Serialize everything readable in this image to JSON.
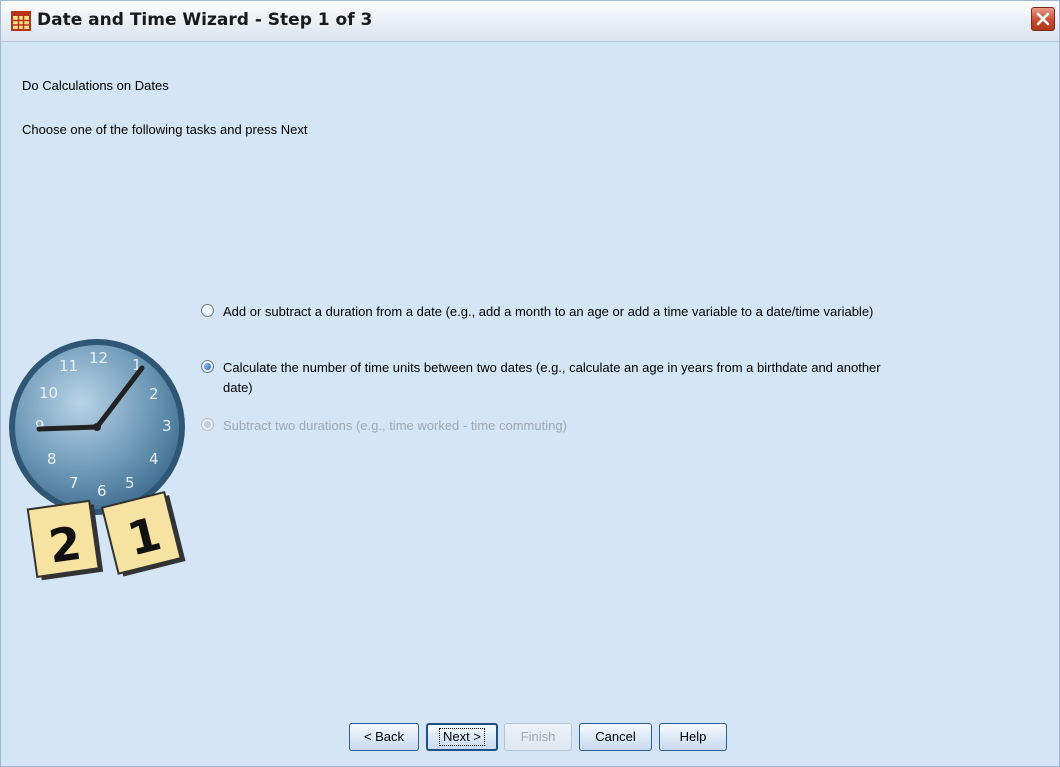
{
  "window": {
    "title": "Date and Time Wizard - Step 1 of 3",
    "app_icon": "spreadsheet-icon",
    "close_icon": "close-icon"
  },
  "content": {
    "heading": "Do Calculations on Dates",
    "instruction": "Choose one of the following tasks and press Next",
    "illustration": "clock-calendar-icon",
    "options": [
      {
        "label": "Add or subtract a duration from a date (e.g., add a month to an age or add a time variable to a date/time variable)",
        "checked": false,
        "enabled": true
      },
      {
        "label": "Calculate the number of time units between two dates (e.g., calculate an age in years from a birthdate and another date)",
        "checked": true,
        "enabled": true
      },
      {
        "label": "Subtract two durations (e.g., time worked - time commuting)",
        "checked": false,
        "enabled": false
      }
    ]
  },
  "buttons": {
    "back": "< Back",
    "next": "Next >",
    "finish": "Finish",
    "cancel": "Cancel",
    "help": "Help"
  },
  "colors": {
    "background": "#d4e5f5",
    "radio_selected": "#1f5fb0",
    "disabled_text": "#a0a8b2"
  }
}
